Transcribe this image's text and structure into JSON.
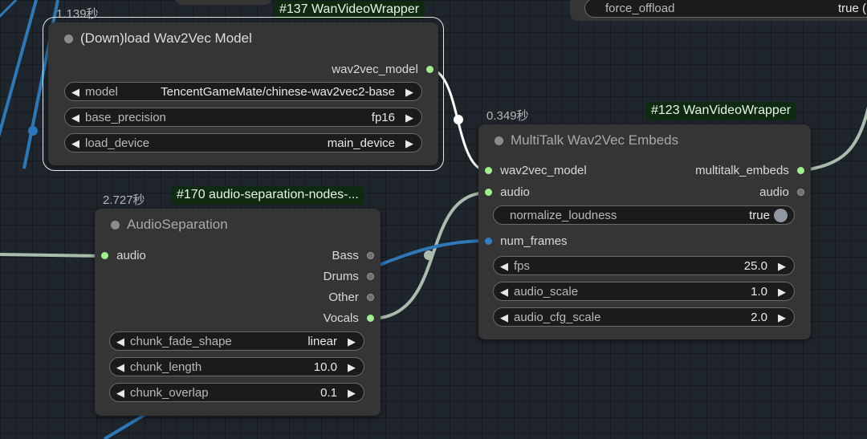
{
  "top_node": {
    "widget_name": "force_offload",
    "widget_value": "true ("
  },
  "node137": {
    "time": "1.139秒",
    "badge": "#137 WanVideoWrapper",
    "title": "(Down)load Wav2Vec Model",
    "output": "wav2vec_model",
    "widgets": [
      {
        "name": "model",
        "value": "TencentGameMate/chinese-wav2vec2-base"
      },
      {
        "name": "base_precision",
        "value": "fp16"
      },
      {
        "name": "load_device",
        "value": "main_device"
      }
    ]
  },
  "node170": {
    "time": "2.727秒",
    "badge": "#170 audio-separation-nodes-...",
    "title": "AudioSeparation",
    "input": "audio",
    "outputs": [
      "Bass",
      "Drums",
      "Other",
      "Vocals"
    ],
    "widgets": [
      {
        "name": "chunk_fade_shape",
        "value": "linear"
      },
      {
        "name": "chunk_length",
        "value": "10.0"
      },
      {
        "name": "chunk_overlap",
        "value": "0.1"
      }
    ]
  },
  "node123": {
    "time": "0.349秒",
    "badge": "#123 WanVideoWrapper",
    "title": "MultiTalk Wav2Vec Embeds",
    "inputs": [
      "wav2vec_model",
      "audio",
      "num_frames"
    ],
    "outputs": [
      "multitalk_embeds",
      "audio"
    ],
    "toggle": {
      "name": "normalize_loudness",
      "value": "true"
    },
    "widgets": [
      {
        "name": "fps",
        "value": "25.0"
      },
      {
        "name": "audio_scale",
        "value": "1.0"
      },
      {
        "name": "audio_cfg_scale",
        "value": "2.0"
      }
    ]
  },
  "colors": {
    "canvas": "#1f252c",
    "node": "#353535",
    "badge": "#0e2a10",
    "socket_green": "#9ff08b",
    "socket_blue": "#2e7fc1",
    "wire_blue": "#2c78b8",
    "wire_audio": "#a9bcae",
    "wire_white": "#ffffff"
  },
  "icons": {
    "left_arrow": "◀",
    "right_arrow": "▶"
  }
}
